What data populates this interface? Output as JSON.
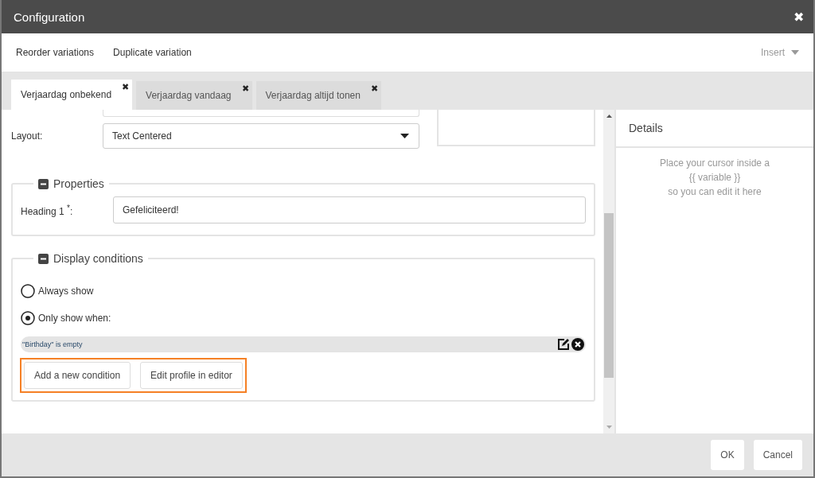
{
  "window": {
    "title": "Configuration",
    "close": "✖"
  },
  "toolbar": {
    "items": [
      "Reorder variations",
      "Duplicate variation"
    ],
    "insert": "Insert"
  },
  "tabs": [
    {
      "label": "Verjaardag onbekend",
      "selected": true,
      "close": "✖"
    },
    {
      "label": "Verjaardag vandaag",
      "selected": false,
      "close": "✖"
    },
    {
      "label": "Verjaardag altijd tonen",
      "selected": false,
      "close": "✖"
    }
  ],
  "layout": {
    "label": "Layout:",
    "value": "Text Centered"
  },
  "properties": {
    "title": "Properties",
    "expanded": true,
    "fields": [
      {
        "label": "Heading 1 $^{*}$:",
        "value": "Gefeliciteerd!"
      }
    ]
  },
  "display_conditions": {
    "title": "Display conditions",
    "expanded": true,
    "options": [
      {
        "label": "Always show",
        "selected": false
      },
      {
        "label": "Only show when:",
        "selected": true
      }
    ],
    "conditions": [
      {
        "text": "\"Birthday\" is empty"
      }
    ],
    "buttons": [
      "Add a new condition",
      "Edit profile in editor"
    ],
    "highlighted": true
  },
  "details": {
    "title": "Details",
    "lines": [
      "Place your cursor inside a",
      "{{ variable }}",
      "so you can edit it here"
    ]
  },
  "footer": {
    "buttons": [
      "OK",
      "Cancel"
    ]
  }
}
